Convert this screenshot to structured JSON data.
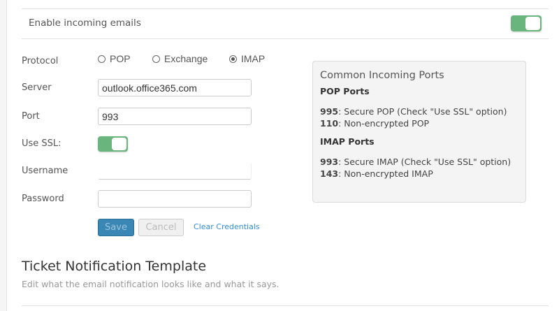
{
  "enable_incoming": {
    "label": "Enable incoming emails",
    "enabled": true
  },
  "form": {
    "protocol_label": "Protocol",
    "protocols": [
      {
        "label": "POP",
        "selected": false
      },
      {
        "label": "Exchange",
        "selected": false
      },
      {
        "label": "IMAP",
        "selected": true
      }
    ],
    "server_label": "Server",
    "server_value": "outlook.office365.com",
    "port_label": "Port",
    "port_value": "993",
    "ssl_label": "Use SSL:",
    "ssl_enabled": true,
    "username_label": "Username",
    "username_value": "",
    "password_label": "Password",
    "password_value": "",
    "save_label": "Save",
    "cancel_label": "Cancel",
    "clear_label": "Clear Credentials"
  },
  "ports_box": {
    "title": "Common Incoming Ports",
    "pop_heading": "POP Ports",
    "pop": [
      {
        "port": "995",
        "desc": ": Secure POP (Check \"Use SSL\" option)"
      },
      {
        "port": "110",
        "desc": ": Non-encrypted POP"
      }
    ],
    "imap_heading": "IMAP Ports",
    "imap": [
      {
        "port": "993",
        "desc": ": Secure IMAP (Check \"Use SSL\" option)"
      },
      {
        "port": "143",
        "desc": ": Non-encrypted IMAP"
      }
    ]
  },
  "template_section": {
    "title": "Ticket Notification Template",
    "subtitle": "Edit what the email notification looks like and what it says."
  },
  "colors": {
    "toggle_on": "#6ab57e",
    "primary": "#3a87b6",
    "link": "#2f8fd8"
  }
}
